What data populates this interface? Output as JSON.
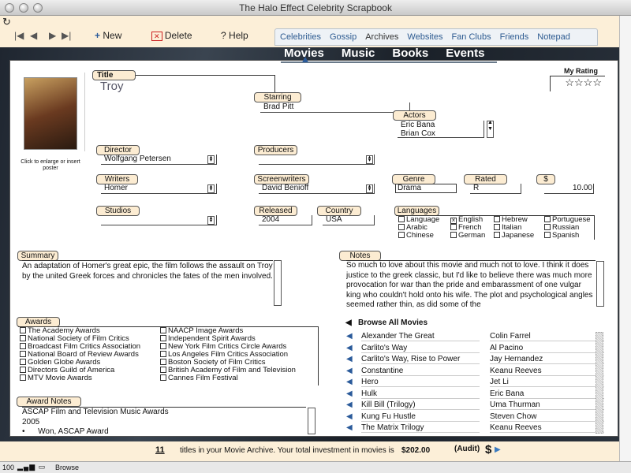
{
  "window": {
    "title": "The Halo Effect Celebrity Scrapbook"
  },
  "toolbar": {
    "new_label": "New",
    "delete_label": "Delete",
    "help_label": "Help"
  },
  "tabs": [
    "Celebrities",
    "Gossip",
    "Archives",
    "Websites",
    "Fan Clubs",
    "Friends",
    "Notepad"
  ],
  "active_tab": "Archives",
  "subnav": [
    "Movies",
    "Music",
    "Books",
    "Events"
  ],
  "poster": {
    "caption": "Click to enlarge or insert poster"
  },
  "rating": {
    "label": "My Rating",
    "stars": "☆☆☆☆",
    "value": 4
  },
  "fields": {
    "title_label": "Title",
    "title": "Troy",
    "starring_label": "Starring",
    "starring": "Brad Pitt",
    "actors_label": "Actors",
    "actors": [
      "Eric Bana",
      "Brian Cox"
    ],
    "director_label": "Director",
    "director": "Wolfgang Petersen",
    "producers_label": "Producers",
    "producers": "",
    "writers_label": "Writers",
    "writers": "Homer",
    "screenwriters_label": "Screenwriters",
    "screenwriters": "David Benioff",
    "genre_label": "Genre",
    "genre": "Drama",
    "rated_label": "Rated",
    "rated": "R",
    "price_label": "$",
    "price": "10.00",
    "studios_label": "Studios",
    "studios": "",
    "released_label": "Released",
    "released": "2004",
    "country_label": "Country",
    "country": "USA"
  },
  "languages": {
    "label": "Languages",
    "items": [
      {
        "name": "Language",
        "checked": false
      },
      {
        "name": "English",
        "checked": true
      },
      {
        "name": "Hebrew",
        "checked": false
      },
      {
        "name": "Portuguese",
        "checked": false
      },
      {
        "name": "Arabic",
        "checked": false
      },
      {
        "name": "French",
        "checked": false
      },
      {
        "name": "Italian",
        "checked": false
      },
      {
        "name": "Russian",
        "checked": false
      },
      {
        "name": "Chinese",
        "checked": false
      },
      {
        "name": "German",
        "checked": false
      },
      {
        "name": "Japanese",
        "checked": false
      },
      {
        "name": "Spanish",
        "checked": false
      }
    ]
  },
  "summary": {
    "label": "Summary",
    "text": "An adaptation of Homer's great epic, the film follows the assault on Troy by the united Greek forces and chronicles the fates of the men involved."
  },
  "notes": {
    "label": "Notes",
    "text": "So much to love about this movie and much not to love.  I think it does justice to the greek classic, but I'd like to believe there was much more provocation for war than the pride and embarassment of one vulgar king who couldn't hold onto his wife.  The plot and psychological angles seemed rather thin, as did some of the"
  },
  "awards": {
    "label": "Awards",
    "items": [
      "The Academy Awards",
      "National Society of Film Critics",
      "Broadcast Film Critics Association",
      "National Board of Review Awards",
      "Golden Globe Awards",
      "Directors Guild of America",
      "MTV Movie Awards",
      "NAACP Image Awards",
      "Independent Spirit Awards",
      "New York Film Critics Circle Awards",
      "Los Angeles Film Critics Association",
      "Boston Society of Film Critics",
      "British Academy of Film and Television",
      "Cannes Film Festival"
    ]
  },
  "award_notes": {
    "label": "Award Notes",
    "lines": [
      "ASCAP Film and Television Music Awards",
      "2005",
      "•      Won, ASCAP Award"
    ]
  },
  "browse": {
    "label": "Browse All Movies",
    "rows": [
      {
        "title": "Alexander The Great",
        "actor": "Colin Farrel"
      },
      {
        "title": "Carlito's Way",
        "actor": "Al Pacino"
      },
      {
        "title": "Carlito's Way, Rise to Power",
        "actor": "Jay Hernandez"
      },
      {
        "title": "Constantine",
        "actor": "Keanu Reeves"
      },
      {
        "title": "Hero",
        "actor": "Jet Li"
      },
      {
        "title": "Hulk",
        "actor": "Eric Bana"
      },
      {
        "title": "Kill Bill (Trilogy)",
        "actor": "Uma Thurman"
      },
      {
        "title": "Kung Fu Hustle",
        "actor": "Steven Chow"
      },
      {
        "title": "The Matrix Trilogy",
        "actor": "Keanu Reeves"
      }
    ]
  },
  "status": {
    "count": "11",
    "text1": "titles in your Movie Archive.  Your total investment in movies is",
    "total": "$202.00",
    "audit": "(Audit)",
    "dollar": "$"
  },
  "bottom": {
    "zoom": "100",
    "mode": "Browse"
  }
}
